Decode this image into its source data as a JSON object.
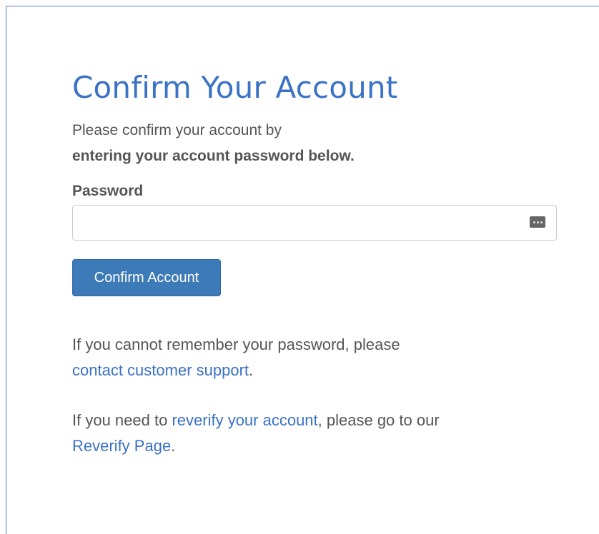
{
  "page": {
    "title": "Confirm Your Account",
    "intro_line1": "Please confirm your account by",
    "intro_line2": "entering your account password below."
  },
  "form": {
    "password_label": "Password",
    "password_value": "",
    "password_icon": "password-dots-icon",
    "submit_label": "Confirm Account"
  },
  "help": {
    "forgot_text": "If you cannot remember your password, please",
    "support_link": "contact customer support",
    "support_suffix": ".",
    "reverify_prefix": "If you need to",
    "reverify_link": "reverify your account",
    "reverify_mid": ", please go to our",
    "reverify_page_link": "Reverify Page",
    "reverify_suffix": "."
  },
  "colors": {
    "accent": "#3a72c6",
    "button": "#3d7ab8",
    "text": "#555555",
    "frame_border": "#5b7fc0"
  }
}
